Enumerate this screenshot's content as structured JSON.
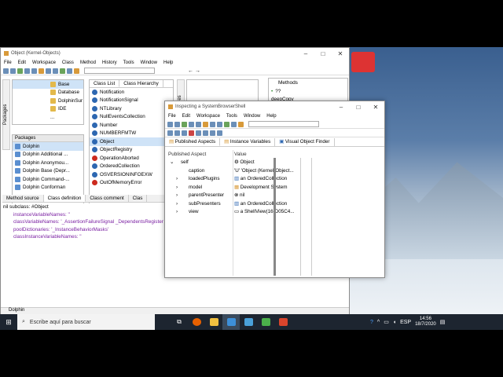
{
  "class_browser": {
    "title": "Object (Kernel-Objects)",
    "menu": [
      "File",
      "Edit",
      "Workspace",
      "Class",
      "Method",
      "History",
      "Tools",
      "Window",
      "Help"
    ],
    "side_tab_packages": "Packages",
    "side_tab_categories": "egories",
    "namespace_tree": [
      "Base",
      "Database",
      "DolphinSur",
      "IDE",
      "..."
    ],
    "packages_header": "Packages",
    "packages": [
      "Dolphin",
      "Dolphin Additional ...",
      "Dolphin Anonymou...",
      "Dolphin Base (Depr...",
      "Dolphin Command-...",
      "Dolphin Conforman"
    ],
    "class_tabs": [
      "Class List",
      "Class Hierarchy"
    ],
    "classes": [
      {
        "name": "Notification",
        "red": false
      },
      {
        "name": "NotificationSignal",
        "red": false
      },
      {
        "name": "NTLibrary",
        "red": false
      },
      {
        "name": "NullEventsCollection",
        "red": false
      },
      {
        "name": "Number",
        "red": false
      },
      {
        "name": "NUMBERFMTW",
        "red": false
      },
      {
        "name": "Object",
        "red": false
      },
      {
        "name": "ObjectRegistry",
        "red": false
      },
      {
        "name": "OperationAborted",
        "red": true
      },
      {
        "name": "OrderedCollection",
        "red": false
      },
      {
        "name": "OSVERSIONINFOEXW",
        "red": false
      },
      {
        "name": "OutOfMemoryError",
        "red": true
      }
    ],
    "methods_header": "Methods",
    "methods": [
      "??",
      "deepCopy"
    ],
    "bottom_tabs": [
      "Method source",
      "Class definition",
      "Class comment",
      "Clas"
    ],
    "code_lines": [
      "nil subclass: #Object",
      "    instanceVariableNames: ''",
      "    classVariableNames: '_AssertionFailureSignal _DependentsRegister",
      "    poolDictionaries: '_InstanceBehaviorMasks'",
      "    classInstanceVariableNames: ''"
    ],
    "status": "Dolphin"
  },
  "inspector": {
    "title": "Inspecting a SystemBrowserShell",
    "menu": [
      "File",
      "Edit",
      "Workspace",
      "Tools",
      "Window",
      "Help"
    ],
    "tabs": [
      "Published Aspects",
      "Instance Variables",
      "Visual Object Finder"
    ],
    "col_aspect": "Published Aspect",
    "col_value": "Value",
    "rows": [
      {
        "aspect": "self",
        "value": "",
        "expand": "⌄",
        "indent": 0
      },
      {
        "aspect": "caption",
        "value": "'Object (Kernel-Object...",
        "expand": "",
        "indent": 1
      },
      {
        "aspect": "loadedPlugins",
        "value": "an OrderedCollection",
        "expand": "›",
        "indent": 1
      },
      {
        "aspect": "model",
        "value": "Development System",
        "expand": "›",
        "indent": 1
      },
      {
        "aspect": "parentPresenter",
        "value": "nil",
        "expand": "›",
        "indent": 1
      },
      {
        "aspect": "subPresenters",
        "value": "an OrderedCollection",
        "expand": "›",
        "indent": 1
      },
      {
        "aspect": "view",
        "value": "a ShellView(16rD05C4...",
        "expand": "›",
        "indent": 1
      }
    ],
    "self_value": "Object"
  },
  "taskbar": {
    "search_placeholder": "Escribe aquí para buscar",
    "lang": "ESP",
    "time": "14:56",
    "date": "18/7/2020"
  },
  "colors": {
    "accent": "#2d67b1",
    "error": "#cc2a1e",
    "taskbar": "#1d2530"
  }
}
